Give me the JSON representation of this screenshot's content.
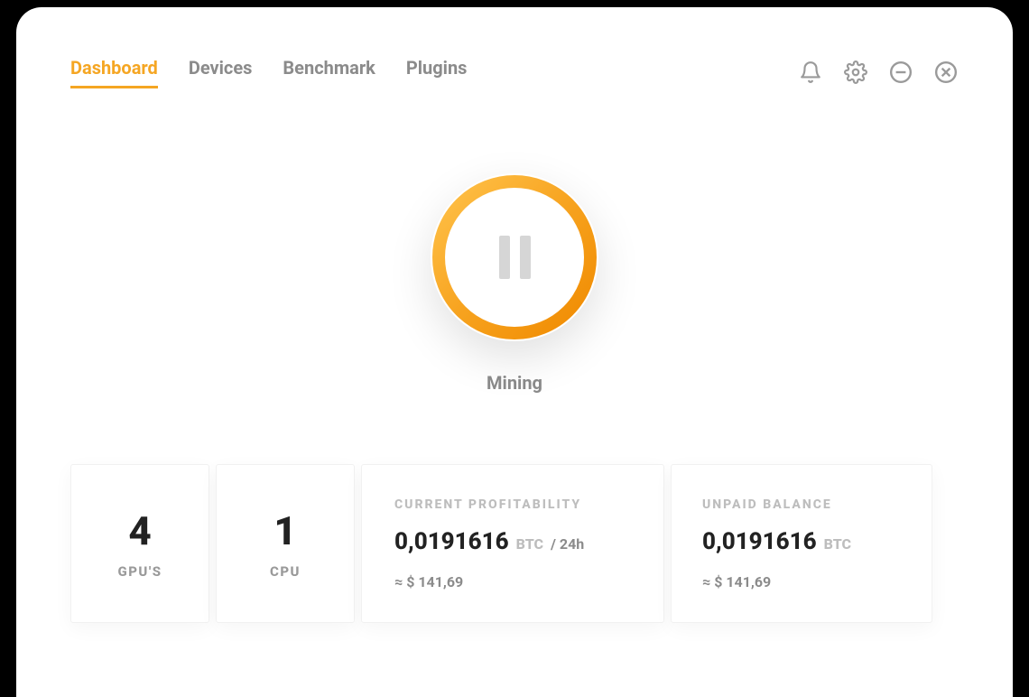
{
  "nav": {
    "tabs": [
      {
        "label": "Dashboard",
        "active": true
      },
      {
        "label": "Devices",
        "active": false
      },
      {
        "label": "Benchmark",
        "active": false
      },
      {
        "label": "Plugins",
        "active": false
      }
    ]
  },
  "icons": {
    "bell": "bell-icon",
    "gear": "gear-icon",
    "minimize": "minimize-icon",
    "close": "close-icon"
  },
  "mining": {
    "status_label": "Mining",
    "action_icon": "pause"
  },
  "stats": {
    "gpus": {
      "value": "4",
      "label": "GPU'S"
    },
    "cpu": {
      "value": "1",
      "label": "CPU"
    },
    "profitability": {
      "title": "CURRENT PROFITABILITY",
      "amount": "0,0191616",
      "unit": "BTC",
      "per": "/ 24h",
      "approx": "≈ $ 141,69"
    },
    "balance": {
      "title": "UNPAID BALANCE",
      "amount": "0,0191616",
      "unit": "BTC",
      "approx": "≈ $ 141,69"
    }
  },
  "colors": {
    "accent": "#f5a623",
    "accent_dark": "#f08a00"
  }
}
